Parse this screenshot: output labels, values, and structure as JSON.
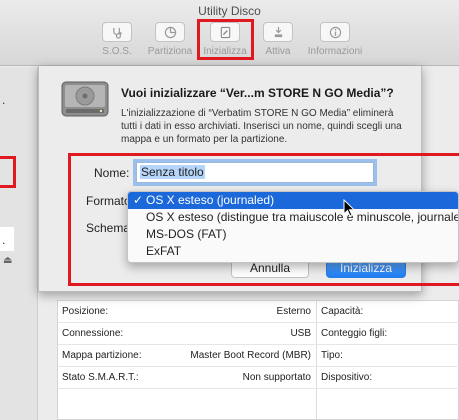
{
  "window": {
    "title": "Utility Disco"
  },
  "toolbar": {
    "items": [
      {
        "label": "S.O.S.",
        "icon": "stethoscope-icon"
      },
      {
        "label": "Partiziona",
        "icon": "pie-chart-icon"
      },
      {
        "label": "Inizializza",
        "icon": "erase-icon"
      },
      {
        "label": "Attiva",
        "icon": "mount-icon"
      },
      {
        "label": "Informazioni",
        "icon": "info-icon"
      }
    ]
  },
  "dialog": {
    "title": "Vuoi inizializzare “Ver...m STORE N GO Media”?",
    "description": "L'inizializzazione di “Verbatim STORE N GO Media” eliminerà tutti i dati in esso archiviati. Inserisci un nome, quindi scegli una mappa e un formato per la partizione.",
    "name_label": "Nome:",
    "name_value": "Senza titolo",
    "format_label": "Formato",
    "scheme_label": "Schema",
    "cancel_label": "Annulla",
    "ok_label": "Inizializza"
  },
  "format_menu": {
    "check": "✓",
    "options": [
      "OS X esteso (journaled)",
      "OS X esteso (distingue tra maiuscole e minuscole, journaled)",
      "MS-DOS (FAT)",
      "ExFAT"
    ],
    "selected_index": 0
  },
  "info": {
    "rows": [
      {
        "key": "Posizione:",
        "value": "Esterno",
        "key2": "Capacità:"
      },
      {
        "key": "Connessione:",
        "value": "USB",
        "key2": "Conteggio figli:"
      },
      {
        "key": "Mappa partizione:",
        "value": "Master Boot Record (MBR)",
        "key2": "Tipo:"
      },
      {
        "key": "Stato S.M.A.R.T.:",
        "value": "Non supportato",
        "key2": "Dispositivo:"
      }
    ]
  },
  "colors": {
    "highlight": "#e0181f",
    "accent": "#1a68da"
  }
}
